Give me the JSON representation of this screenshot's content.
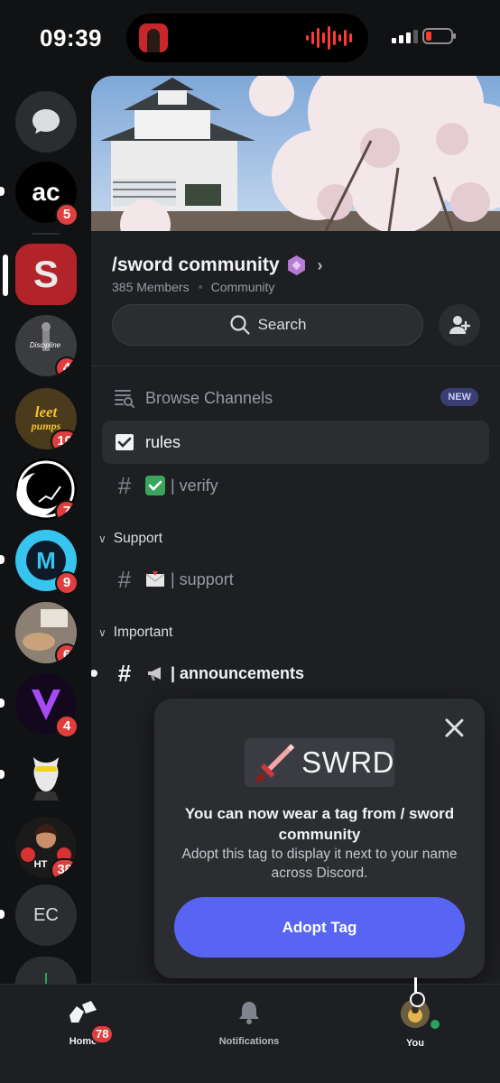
{
  "status_bar": {
    "time": "09:39"
  },
  "rail": {
    "servers": [
      {
        "name": "direct-messages",
        "badge": ""
      },
      {
        "name": "ac",
        "badge": "5"
      },
      {
        "name": "sword",
        "badge": ""
      },
      {
        "name": "discipline",
        "badge": "4",
        "label": "Discipline"
      },
      {
        "name": "leet-pumps",
        "badge": "10",
        "label": "leet pumps"
      },
      {
        "name": "moon-chart",
        "badge": "7"
      },
      {
        "name": "m-logo",
        "badge": "9"
      },
      {
        "name": "cat-photo",
        "badge": "6"
      },
      {
        "name": "v-logo",
        "badge": "4"
      },
      {
        "name": "goat",
        "badge": ""
      },
      {
        "name": "ht",
        "badge": "38",
        "label": "HT"
      },
      {
        "name": "ec",
        "badge": "",
        "label": "EC"
      }
    ]
  },
  "server": {
    "name": "/sword community",
    "members": "385 Members",
    "type": "Community",
    "search_label": "Search"
  },
  "channels": {
    "browse_label": "Browse Channels",
    "new_badge": "NEW",
    "rules": "rules",
    "verify": "| verify",
    "support_category": "Support",
    "support": "| support",
    "important_category": "Important",
    "announcements": "| announcements"
  },
  "popup": {
    "tag_text": "SWRD",
    "title": "You can now wear a tag from / sword community",
    "description": "Adopt this tag to display it next to your name across Discord.",
    "button": "Adopt Tag"
  },
  "bottom_nav": {
    "home": "Home",
    "home_badge": "78",
    "notifications": "Notifications",
    "you": "You"
  },
  "colors": {
    "accent": "#5865f2",
    "badge": "#e03e3e",
    "online": "#23a55a"
  }
}
